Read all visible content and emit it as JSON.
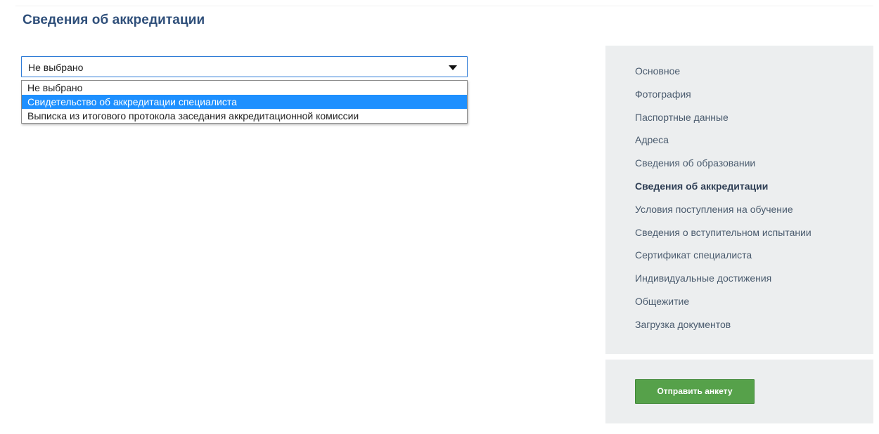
{
  "page": {
    "title": "Сведения об аккредитации"
  },
  "select": {
    "value": "Не выбрано",
    "options": [
      {
        "label": "Не выбрано",
        "selected": false
      },
      {
        "label": "Свидетельство об аккредитации специалиста",
        "selected": true
      },
      {
        "label": "Выписка из итогового протокола заседания аккредитационной комиссии",
        "selected": false
      }
    ]
  },
  "sidebar": {
    "items": [
      {
        "label": "Основное",
        "active": false
      },
      {
        "label": "Фотография",
        "active": false
      },
      {
        "label": "Паспортные данные",
        "active": false
      },
      {
        "label": "Адреса",
        "active": false
      },
      {
        "label": "Сведения об образовании",
        "active": false
      },
      {
        "label": "Сведения об аккредитации",
        "active": true
      },
      {
        "label": "Условия поступления на обучение",
        "active": false
      },
      {
        "label": "Сведения о вступительном испытании",
        "active": false
      },
      {
        "label": "Сертификат специалиста",
        "active": false
      },
      {
        "label": "Индивидуальные достижения",
        "active": false
      },
      {
        "label": "Общежитие",
        "active": false
      },
      {
        "label": "Загрузка документов",
        "active": false
      }
    ],
    "submit_label": "Отправить анкету"
  },
  "colors": {
    "title": "#2f4f7a",
    "option_highlight": "#1e90ff",
    "sidebar_bg": "#eceeef",
    "submit_bg": "#56a14a"
  },
  "icons": {
    "select_arrow": "caret-down-icon"
  }
}
